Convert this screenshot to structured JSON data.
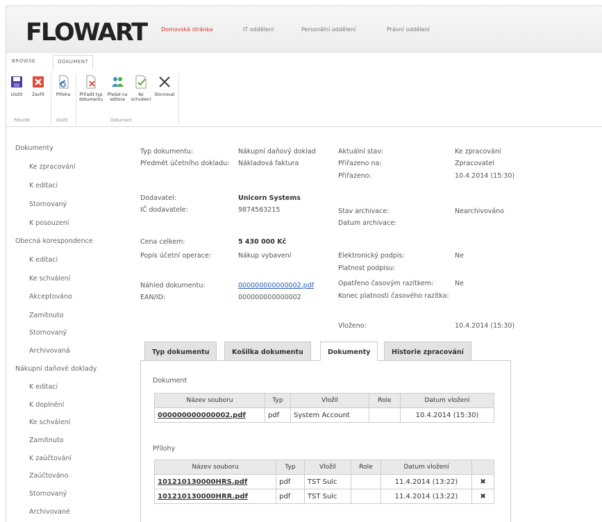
{
  "header": {
    "logo": "FLOWART",
    "nav": [
      "Domovská stránka",
      "IT oddělení",
      "Personální oddělení",
      "Právní oddělení"
    ]
  },
  "ribbon": {
    "tabs": [
      "BROWSE",
      "DOKUMENT"
    ],
    "buttons": {
      "save": "Uložit",
      "close": "Zavřít",
      "attachment": "Příloha",
      "assign_type": "Přiřadit typ dokumentu",
      "send_editor": "Předat na editora",
      "approve": "Ke schválení",
      "cancel": "Storno­vat"
    },
    "groups": [
      "Potvrdit",
      "Vložit",
      "Dokument"
    ]
  },
  "sidebar": [
    {
      "label": "Dokumenty",
      "level": 1
    },
    {
      "label": "Ke zpracování",
      "level": 2
    },
    {
      "label": "K editaci",
      "level": 2
    },
    {
      "label": "Stornovaný",
      "level": 2
    },
    {
      "label": "K posouzení",
      "level": 2
    },
    {
      "label": "Obecná korespondence",
      "level": 1
    },
    {
      "label": "K editaci",
      "level": 2
    },
    {
      "label": "Ke schválení",
      "level": 2
    },
    {
      "label": "Akceptováno",
      "level": 2
    },
    {
      "label": "Zamítnuto",
      "level": 2
    },
    {
      "label": "Stornovaný",
      "level": 2
    },
    {
      "label": "Archivovaná",
      "level": 2
    },
    {
      "label": "Nákupní daňové doklady",
      "level": 1
    },
    {
      "label": "K editaci",
      "level": 2
    },
    {
      "label": "K doplnění",
      "level": 2
    },
    {
      "label": "Ke schválení",
      "level": 2
    },
    {
      "label": "Zamítnuto",
      "level": 2
    },
    {
      "label": "K zaúčtování",
      "level": 2
    },
    {
      "label": "Zaúčtováno",
      "level": 2
    },
    {
      "label": "Stornovaný",
      "level": 2
    },
    {
      "label": "Archivované",
      "level": 2
    }
  ],
  "details": {
    "typ_label": "Typ dokumentu:",
    "typ_value": "Nákupní daňový doklad",
    "predmet_label": "Předmět účetního dokladu:",
    "predmet_value": "Nákladová faktura",
    "dodavatel_label": "Dodavatel:",
    "dodavatel_value": "Unicorn Systems",
    "ic_label": "IČ dodavatele:",
    "ic_value": "9874563215",
    "cena_label": "Cena celkem:",
    "cena_value": "5 430 000 Kč",
    "popis_label": "Popis účetní operace:",
    "popis_value": "Nákup vybavení",
    "nahled_label": "Náhled dokumentu:",
    "nahled_value": "000000000000002.pdf",
    "ean_label": "EAN/ID:",
    "ean_value": "000000000000002",
    "stav_label": "Aktuální stav:",
    "stav_value": "Ke zpracování",
    "prirazeno_na_label": "Přiřazeno na:",
    "prirazeno_na_value": "Zpracovatel",
    "prirazeno_label": "Přiřazeno:",
    "prirazeno_value": "10.4.2014 (15:30)",
    "archivace_label": "Stav archivace:",
    "archivace_value": "Nearchivováno",
    "datum_archivace_label": "Datum archivace:",
    "podpis_label": "Elektronický podpis:",
    "podpis_value": "Ne",
    "platnost_label": "Platnost podpisu:",
    "razitko_label": "Opatřeno časovým razítkem:",
    "razitko_value": "Ne",
    "konec_label": "Konec platnosti časového razítka:",
    "vlozeno_label": "Vloženo:",
    "vlozeno_value": "10.4.2014 (15:30)"
  },
  "tabs": [
    "Typ dokumentu",
    "Košilka dokumentu",
    "Dokumenty",
    "Historie zpracování"
  ],
  "dokument_section": {
    "title": "Dokument",
    "columns": [
      "Název souboru",
      "Typ",
      "Vložil",
      "Role",
      "Datum vložení"
    ],
    "rows": [
      [
        "000000000000002.pdf",
        "pdf",
        "System Account",
        "",
        "10.4.2014 (15:30)"
      ]
    ]
  },
  "prilohy_section": {
    "title": "Přílohy",
    "columns": [
      "Název souboru",
      "Typ",
      "Vložil",
      "Role",
      "Datum vložení"
    ],
    "rows": [
      [
        "101210130000HRS.pdf",
        "pdf",
        "TST Sulc",
        "",
        "11.4.2014 (13:22)"
      ],
      [
        "101210130000HRR.pdf",
        "pdf",
        "TST Sulc",
        "",
        "11.4.2014 (13:22)"
      ]
    ]
  }
}
